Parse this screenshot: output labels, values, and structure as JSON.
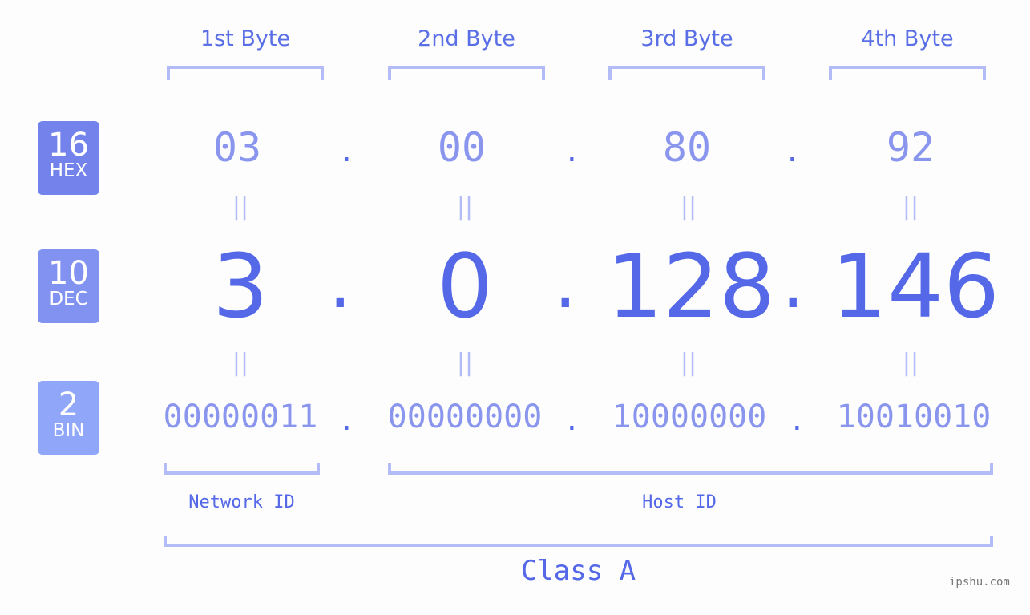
{
  "bytes": [
    {
      "label": "1st Byte",
      "hex": "03",
      "dec": "3",
      "bin": "00000011"
    },
    {
      "label": "2nd Byte",
      "hex": "00",
      "dec": "0",
      "bin": "00000000"
    },
    {
      "label": "3rd Byte",
      "hex": "80",
      "dec": "128",
      "bin": "10000000"
    },
    {
      "label": "4th Byte",
      "hex": "92",
      "dec": "146",
      "bin": "10010010"
    }
  ],
  "separator": ".",
  "equals": "||",
  "badges": {
    "hex": {
      "num": "16",
      "label": "HEX",
      "color": "#7482ec"
    },
    "dec": {
      "num": "10",
      "label": "DEC",
      "color": "#8292f0"
    },
    "bin": {
      "num": "2",
      "label": "BIN",
      "color": "#90a6f8"
    }
  },
  "network_id_label": "Network ID",
  "host_id_label": "Host ID",
  "class_label": "Class A",
  "watermark": "ipshu.com",
  "colors": {
    "accent": "#5468e8",
    "light_text": "#8a96ee",
    "bracket": "#b4bcf8"
  }
}
